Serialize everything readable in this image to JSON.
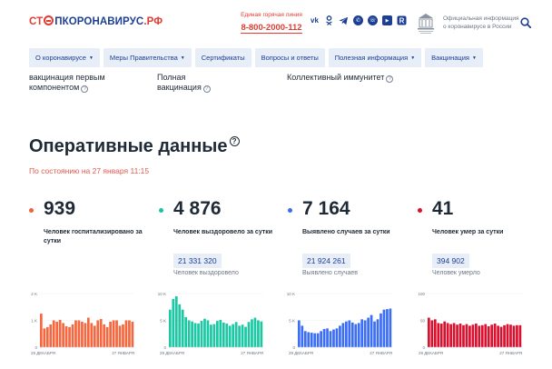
{
  "header": {
    "logo_part1": "СТ",
    "logo_part2": "ПКОРОНАВИРУС",
    "logo_part3": ".РФ",
    "hotline_label": "Единая горячая линия",
    "hotline_number": "8-800-2000-112",
    "socials": [
      "vk",
      "ok",
      "telegram",
      "viber",
      "whatsapp",
      "youtube",
      "r"
    ],
    "official_text": "Официальная информация о коронавирусе в России"
  },
  "nav": [
    {
      "label": "О коронавирусе",
      "has_caret": true
    },
    {
      "label": "Меры Правительства",
      "has_caret": true
    },
    {
      "label": "Сертификаты",
      "has_caret": false
    },
    {
      "label": "Вопросы и ответы",
      "has_caret": false
    },
    {
      "label": "Полезная информация",
      "has_caret": true
    },
    {
      "label": "Вакцинация",
      "has_caret": true
    }
  ],
  "partials": [
    {
      "line1": "вакцинация первым",
      "line2": "компонентом"
    },
    {
      "line1": "Полная",
      "line2": "вакцинация"
    },
    {
      "line1": "Коллективный иммунитет",
      "line2": ""
    }
  ],
  "main": {
    "title": "Оперативные данные",
    "subtitle": "По состоянию на 27 января 11:15"
  },
  "stats": [
    {
      "value": "939",
      "desc": "Человек госпитализировано за сутки",
      "total": "",
      "total_label": "",
      "color": "#f0623a"
    },
    {
      "value": "4 876",
      "desc": "Человек выздоровело за сутки",
      "total": "21 331 320",
      "total_label": "Человек выздоровело",
      "color": "#1dc3a1"
    },
    {
      "value": "7 164",
      "desc": "Выявлено случаев за сутки",
      "total": "21 924 261",
      "total_label": "Выявлено случаев",
      "color": "#3b6cf0"
    },
    {
      "value": "41",
      "desc": "Человек умер за сутки",
      "total": "394 902",
      "total_label": "Человек умерло",
      "color": "#d6112e"
    }
  ],
  "chart_data": [
    {
      "type": "bar",
      "name": "hospitalized",
      "color": "#f5673f",
      "yticks": [
        "2 K",
        "1 K",
        "0"
      ],
      "ylim": [
        0,
        2000
      ],
      "x_start_label": "29 ДЕКАБРЯ",
      "x_end_label": "27 ЯНВАРЯ",
      "values": [
        1250,
        700,
        750,
        850,
        1000,
        950,
        1020,
        900,
        780,
        750,
        850,
        1000,
        1000,
        950,
        900,
        1100,
        900,
        800,
        1000,
        1050,
        850,
        750,
        950,
        1000,
        1000,
        800,
        850,
        1000,
        1000,
        950
      ]
    },
    {
      "type": "bar",
      "name": "recovered",
      "color": "#1cc7a3",
      "yticks": [
        "10 K",
        "5 K",
        "0"
      ],
      "ylim": [
        0,
        10000
      ],
      "x_start_label": "29 ДЕКАБРЯ",
      "x_end_label": "27 ЯНВАРЯ",
      "values": [
        7000,
        9000,
        9500,
        8000,
        7000,
        5600,
        5000,
        4800,
        4500,
        4400,
        4900,
        5300,
        5000,
        4200,
        4300,
        4900,
        5100,
        4600,
        4400,
        4000,
        4300,
        4700,
        4000,
        4200,
        3800,
        4700,
        5200,
        5500,
        5000,
        4800
      ]
    },
    {
      "type": "bar",
      "name": "cases",
      "color": "#3b6ef5",
      "yticks": [
        "10 K",
        "5 K",
        "0"
      ],
      "ylim": [
        0,
        10000
      ],
      "x_start_label": "29 ДЕКАБРЯ",
      "x_end_label": "27 ЯНВАРЯ",
      "values": [
        5000,
        4000,
        3000,
        2800,
        2700,
        2600,
        2600,
        3000,
        3400,
        3500,
        3000,
        3300,
        3500,
        4000,
        4500,
        4800,
        5000,
        4600,
        4300,
        4500,
        5200,
        5000,
        5500,
        6000,
        4800,
        5200,
        6300,
        7000,
        7100,
        7200
      ]
    },
    {
      "type": "bar",
      "name": "deaths",
      "color": "#d9112f",
      "yticks": [
        "100",
        "50",
        "0"
      ],
      "ylim": [
        0,
        100
      ],
      "x_start_label": "29 ДЕКАБРЯ",
      "x_end_label": "27 ЯНВАРЯ",
      "values": [
        55,
        50,
        52,
        45,
        44,
        48,
        45,
        43,
        45,
        42,
        44,
        41,
        43,
        40,
        42,
        44,
        40,
        41,
        43,
        39,
        42,
        44,
        40,
        38,
        41,
        43,
        42,
        40,
        41,
        41
      ]
    }
  ]
}
